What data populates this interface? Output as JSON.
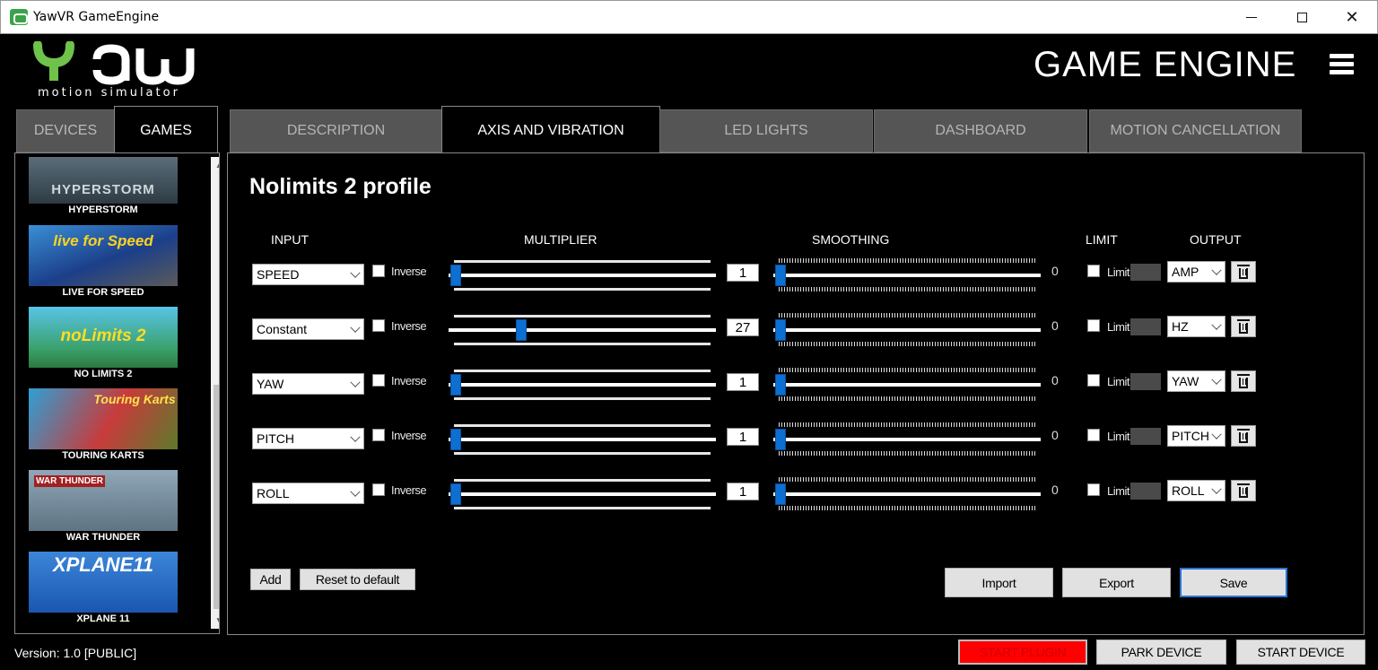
{
  "window": {
    "title": "YawVR GameEngine"
  },
  "brand": {
    "logo_text": "yaw",
    "logo_subtitle": "motion simulator",
    "app_title": "GAME ENGINE",
    "accent_color": "#6fc24a"
  },
  "left_tabs": [
    {
      "label": "DEVICES",
      "active": false
    },
    {
      "label": "GAMES",
      "active": true
    }
  ],
  "games": [
    {
      "name": "HYPERSTORM",
      "thumb_text": "HYPERSTORM"
    },
    {
      "name": "LIVE FOR SPEED",
      "thumb_text": "live for Speed"
    },
    {
      "name": "NO LIMITS 2",
      "thumb_text": "noLimits 2"
    },
    {
      "name": "TOURING KARTS",
      "thumb_text": "Touring Karts"
    },
    {
      "name": "WAR THUNDER",
      "thumb_text": "WAR THUNDER"
    },
    {
      "name": "XPLANE 11",
      "thumb_text": "XPLANE11"
    }
  ],
  "tabs": [
    {
      "label": "DESCRIPTION",
      "active": false
    },
    {
      "label": "AXIS AND VIBRATION",
      "active": true
    },
    {
      "label": "LED LIGHTS",
      "active": false
    },
    {
      "label": "DASHBOARD",
      "active": false
    },
    {
      "label": "MOTION CANCELLATION",
      "active": false
    }
  ],
  "profile_title": "Nolimits 2 profile",
  "columns": {
    "input": "INPUT",
    "multiplier": "MULTIPLIER",
    "smoothing": "SMOOTHING",
    "limit": "LIMIT",
    "output": "OUTPUT"
  },
  "axes": [
    {
      "input": "SPEED",
      "inverse_label": "Inverse",
      "multiplier": "1",
      "multiplier_level": 0.0,
      "smoothing": "0",
      "limit_label": "Limit",
      "output": "AMP"
    },
    {
      "input": "Constant",
      "inverse_label": "Inverse",
      "multiplier": "27",
      "multiplier_level": 0.26,
      "smoothing": "0",
      "limit_label": "Limit",
      "output": "HZ"
    },
    {
      "input": "YAW",
      "inverse_label": "Inverse",
      "multiplier": "1",
      "multiplier_level": 0.0,
      "smoothing": "0",
      "limit_label": "Limit",
      "output": "YAW"
    },
    {
      "input": "PITCH",
      "inverse_label": "Inverse",
      "multiplier": "1",
      "multiplier_level": 0.0,
      "smoothing": "0",
      "limit_label": "Limit",
      "output": "PITCH"
    },
    {
      "input": "ROLL",
      "inverse_label": "Inverse",
      "multiplier": "1",
      "multiplier_level": 0.0,
      "smoothing": "0",
      "limit_label": "Limit",
      "output": "ROLL"
    }
  ],
  "buttons": {
    "add": "Add",
    "reset": "Reset to default",
    "import": "Import",
    "export": "Export",
    "save": "Save"
  },
  "footer": {
    "version": "Version: 1.0 [PUBLIC]",
    "start_plugin": "START PLUGIN",
    "park_device": "PARK DEVICE",
    "start_device": "START DEVICE",
    "start_plugin_color": "#ff0000"
  },
  "icons": {
    "menu": "hamburger-icon",
    "trash": "trash-icon",
    "close": "close-icon",
    "maximize": "maximize-icon",
    "minimize": "minimize-icon"
  }
}
